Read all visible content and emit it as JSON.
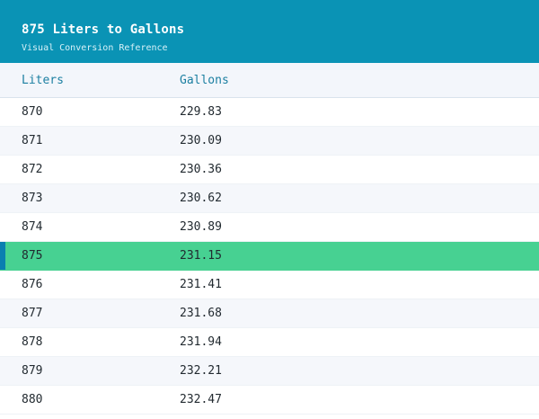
{
  "header": {
    "title": "875 Liters to Gallons",
    "subtitle": "Visual Conversion Reference"
  },
  "columns": {
    "liters": "Liters",
    "gallons": "Gallons"
  },
  "rows": [
    {
      "liters": "870",
      "gallons": "229.83"
    },
    {
      "liters": "871",
      "gallons": "230.09"
    },
    {
      "liters": "872",
      "gallons": "230.36"
    },
    {
      "liters": "873",
      "gallons": "230.62"
    },
    {
      "liters": "874",
      "gallons": "230.89"
    },
    {
      "liters": "875",
      "gallons": "231.15"
    },
    {
      "liters": "876",
      "gallons": "231.41"
    },
    {
      "liters": "877",
      "gallons": "231.68"
    },
    {
      "liters": "878",
      "gallons": "231.94"
    },
    {
      "liters": "879",
      "gallons": "232.21"
    },
    {
      "liters": "880",
      "gallons": "232.47"
    }
  ],
  "highlighted_row_index": 5,
  "colors": {
    "header_bg": "#0a93b5",
    "highlight": "#47d192",
    "highlight_marker": "#0a7fb0",
    "column_text": "#1b7fa1"
  }
}
